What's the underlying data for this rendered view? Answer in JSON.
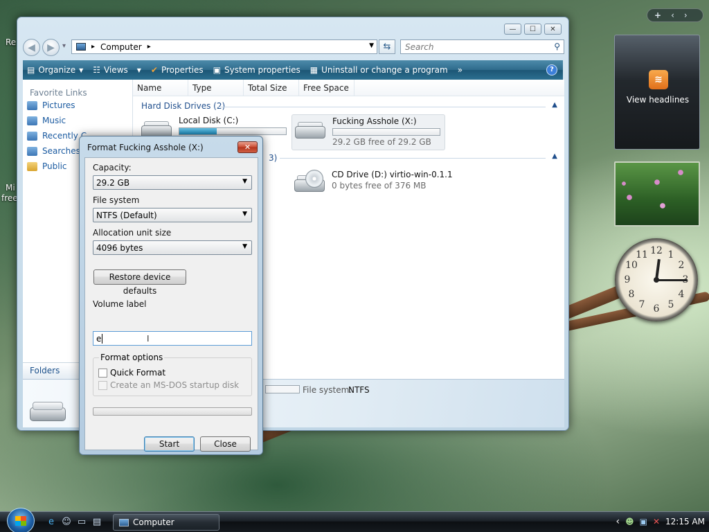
{
  "desktop": {
    "frag_re": "Re",
    "frag_mi": "Mi",
    "frag_free": "free"
  },
  "explorer": {
    "window_controls": {
      "minimize": "—",
      "maximize": "☐",
      "close": "✕"
    },
    "nav": {
      "back": "◀",
      "forward": "▶",
      "dropdown": "▾"
    },
    "address": {
      "icon": "computer-icon",
      "separator": "▸",
      "path": "Computer",
      "trailing_arrow": "▸",
      "drop": "▼"
    },
    "refresh_glyph": "⇆",
    "search_placeholder": "Search",
    "search_glyph": "⚲",
    "toolbar": {
      "organize": "Organize",
      "views": "Views",
      "properties": "Properties",
      "system_properties": "System properties",
      "uninstall": "Uninstall or change a program",
      "overflow": "»",
      "help": "?"
    },
    "sidebar": {
      "title": "Favorite Links",
      "items": [
        "Pictures",
        "Music",
        "Recently C",
        "Searches",
        "Public"
      ],
      "folders": "Folders"
    },
    "columns": [
      "Name",
      "Type",
      "Total Size",
      "Free Space"
    ],
    "groups": {
      "hard_disks": "Hard Disk Drives (2)",
      "removable_suffix": "3)",
      "collapse_glyph": "▲"
    },
    "drives": [
      {
        "name": "Local Disk (C:)",
        "fill": 0.35,
        "sub": ""
      },
      {
        "name": "Fucking Asshole (X:)",
        "fill": 0.0,
        "sub": "29.2 GB free of 29.2 GB"
      },
      {
        "name": "CD Drive (D:) virtio-win-0.1.1",
        "sub": "0 bytes free of 376 MB"
      }
    ],
    "details": {
      "label_prefix": "F",
      "fs_label": "File system:",
      "fs_value": "NTFS"
    }
  },
  "format_dialog": {
    "title": "Format Fucking Asshole (X:)",
    "close": "✕",
    "capacity_label": "Capacity:",
    "capacity_value": "29.2 GB",
    "filesystem_label": "File system",
    "filesystem_value": "NTFS (Default)",
    "alloc_label": "Allocation unit size",
    "alloc_value": "4096 bytes",
    "restore_button": "Restore device defaults",
    "volume_label": "Volume label",
    "volume_value": "e",
    "caret": "I",
    "options_label": "Format options",
    "quick_format": "Quick Format",
    "msdos": "Create an MS-DOS startup disk",
    "start": "Start",
    "close_button": "Close",
    "dropdown_arrow": "▼"
  },
  "gadgets": {
    "sidebar_controls": {
      "add": "+",
      "prev": "‹",
      "next": "›"
    },
    "feed_icon": "rss-icon",
    "feed_text": "View headlines",
    "clock": {
      "hour": 12,
      "minute": 15
    }
  },
  "taskbar": {
    "task_label": "Computer",
    "time": "12:15 AM",
    "tray_arrow": "‹"
  }
}
